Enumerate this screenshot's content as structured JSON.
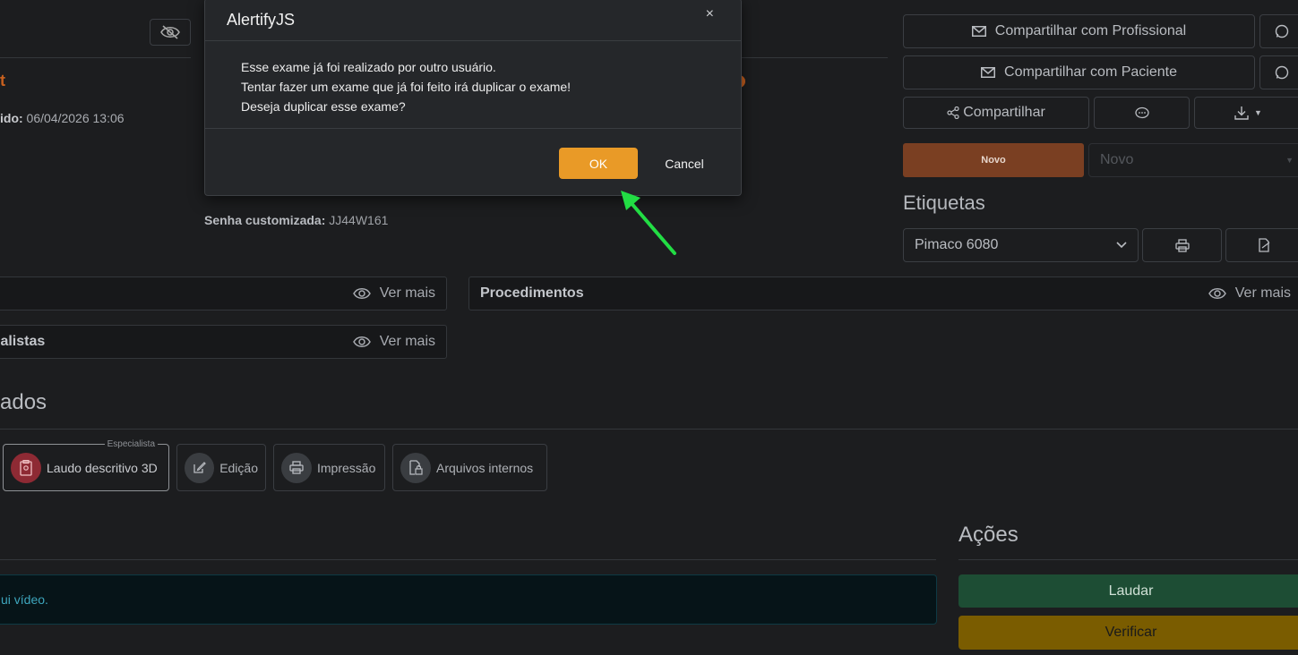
{
  "top": {
    "creation_label": "ido:",
    "creation_value": "06/04/2026 13:06",
    "partial_title": "t",
    "custom_pwd_label": "Senha customizada:",
    "custom_pwd_value": "JJ44W161"
  },
  "share": {
    "professional": "Compartilhar com Profissional",
    "patient": "Compartilhar com Paciente",
    "share": "Compartilhar"
  },
  "status": {
    "badge": "Novo",
    "select_value": "Novo"
  },
  "labels": {
    "title": "Etiquetas",
    "select_value": "Pimaco 6080"
  },
  "panels": {
    "left_top_more": "Ver mais",
    "procedures_title": "Procedimentos",
    "procedures_more": "Ver mais",
    "specialists_title": "ialistas",
    "specialists_more": "Ver mais"
  },
  "section": {
    "title_partial": "ados"
  },
  "steps": {
    "specialist_tag": "Especialista",
    "items": [
      "Laudo descritivo 3D",
      "Edição",
      "Impressão",
      "Arquivos internos"
    ]
  },
  "video": {
    "text": "ui vídeo."
  },
  "actions": {
    "title": "Ações",
    "laudar": "Laudar",
    "verificar": "Verificar"
  },
  "dialog": {
    "title": "AlertifyJS",
    "close": "×",
    "lines": [
      "Esse exame já foi realizado por outro usuário.",
      "Tentar fazer um exame que já foi feito irá duplicar o exame!",
      "Deseja duplicar esse exame?"
    ],
    "ok": "OK",
    "cancel": "Cancel"
  },
  "colors": {
    "accent_orange": "#e99a27",
    "badge_brown": "#7a3f22",
    "laudar_green": "#1d4d34",
    "verificar_yellow": "#7a5c00",
    "arrow_green": "#22dd44"
  }
}
